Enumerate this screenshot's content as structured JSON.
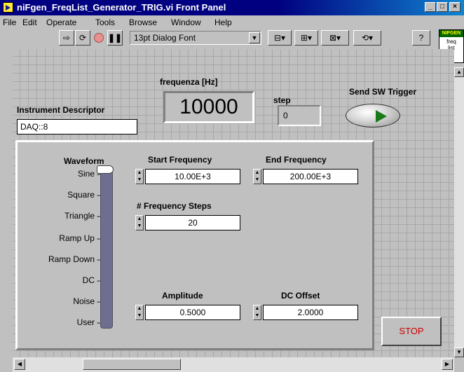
{
  "window": {
    "title": "niFgen_FreqList_Generator_TRIG.vi Front Panel"
  },
  "menu": [
    "File",
    "Edit",
    "Operate",
    "Tools",
    "Browse",
    "Window",
    "Help"
  ],
  "toolbar": {
    "font": "13pt Dialog Font"
  },
  "vi_icon": {
    "header": "NIFGEN",
    "line1": "freq",
    "line2": "list"
  },
  "instrument": {
    "label": "Instrument Descriptor",
    "value": "DAQ::8"
  },
  "frequency": {
    "label": "frequenza [Hz]",
    "value": "10000"
  },
  "step": {
    "label": "step",
    "value": "0"
  },
  "sw_trigger": {
    "label": "Send SW Trigger"
  },
  "waveform": {
    "label": "Waveform",
    "options": [
      "Sine",
      "Square",
      "Triangle",
      "Ramp Up",
      "Ramp Down",
      "DC",
      "Noise",
      "User"
    ],
    "selected": "Sine"
  },
  "start_freq": {
    "label": "Start Frequency",
    "value": "10.00E+3"
  },
  "end_freq": {
    "label": "End Frequency",
    "value": "200.00E+3"
  },
  "freq_steps": {
    "label": "# Frequency Steps",
    "value": "20"
  },
  "amplitude": {
    "label": "Amplitude",
    "value": "0.5000"
  },
  "dc_offset": {
    "label": "DC Offset",
    "value": "2.0000"
  },
  "stop": {
    "label": "STOP"
  }
}
